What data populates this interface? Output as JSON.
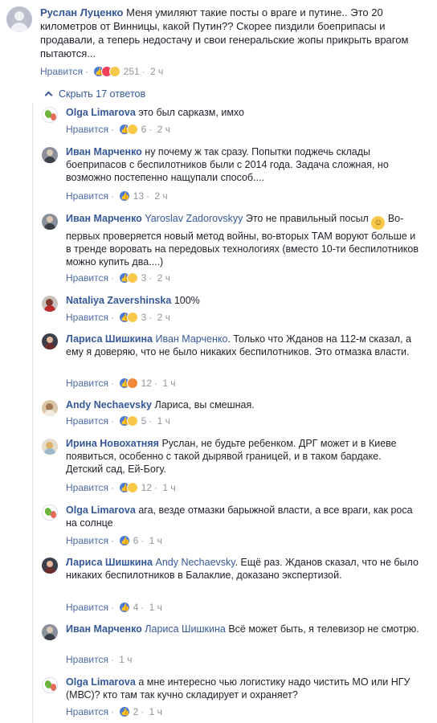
{
  "main": {
    "author": "Руслан Луценко",
    "text": "Меня умиляют такие посты о враге и путине.. Это 20 километров от Винницы, какой Путин?? Скорее пиздили боеприпасы и продавали, а теперь недостачу и свои генеральские жопы прикрыть врагом пытаются...",
    "like_label": "Нравится",
    "reaction_count": "251",
    "time": "2 ч"
  },
  "hide_replies_label": "Скрыть 17 ответов",
  "replies": [
    {
      "author": "Olga Limarova",
      "mention": "",
      "text": "это был сарказм, имхо",
      "like_label": "Нравится",
      "count": "6",
      "time": "2 ч"
    },
    {
      "author": "Иван Марченко",
      "mention": "",
      "text": "ну почему ж так сразу. Попытки поджечь склады боеприпасов с беспилотников были с 2014 года. Задача сложная, но возможно постепенно нащупали способ....",
      "like_label": "Нравится",
      "count": "13",
      "time": "2 ч"
    },
    {
      "author": "Иван Марченко",
      "mention": "Yaroslav Zadorovskyy",
      "text": "Это не правильный посыл",
      "text2": "Во-первых проверяется новый метод войны, во-вторых ТАМ воруют больше и в тренде воровать на передовых технологиях (вместо 10-ти беспилотников можно купить два....)",
      "like_label": "Нравится",
      "count": "3",
      "time": "2 ч"
    },
    {
      "author": "Nataliya Zavershinska",
      "mention": "",
      "text": "100%",
      "like_label": "Нравится",
      "count": "3",
      "time": "2 ч"
    },
    {
      "author": "Лариса Шишкина",
      "mention": "Иван Марченко",
      "text": ". Только что Жданов на 112-м сказал, а ему я доверяю, что не было никаких беспилотников. Это отмазка власти.",
      "like_label": "Нравится",
      "count": "12",
      "time": "1 ч"
    },
    {
      "author": "Andy Nechaevsky",
      "mention": "",
      "text": "Лариса, вы смешная.",
      "like_label": "Нравится",
      "count": "5",
      "time": "1 ч"
    },
    {
      "author": "Ирина Новохатняя",
      "mention": "",
      "text": "Руслан, не будьте ребенком. ДРГ может и в Киеве появиться, особенно с такой дырявой границей, и в таком бардаке. Детский сад, Ей-Богу.",
      "like_label": "Нравится",
      "count": "12",
      "time": "1 ч"
    },
    {
      "author": "Olga Limarova",
      "mention": "",
      "text": "ага, везде отмазки барыжной власти, а все враги, как роса на солнце",
      "like_label": "Нравится",
      "count": "6",
      "time": "1 ч"
    },
    {
      "author": "Лариса Шишкина",
      "mention": "Andy Nechaevsky",
      "text": ". Ещё раз. Жданов сказал, что не было никаких беспилотников в Балаклие, доказано экспертизой.",
      "like_label": "Нравится",
      "count": "4",
      "time": "1 ч"
    },
    {
      "author": "Иван Марченко",
      "mention": "Лариса Шишкина",
      "text": "Всё может быть, я телевизор не смотрю.",
      "like_label": "Нравится",
      "count": "",
      "time": "1 ч"
    },
    {
      "author": "Olga Limarova",
      "mention": "",
      "text": "а мне интересно чью логистику надо чистить МО или НГУ (МВС)? кто там так кучно складирует и охраняет?",
      "like_label": "Нравится",
      "count": "2",
      "time": "1 ч"
    }
  ],
  "colors": {
    "link": "#365899",
    "meta": "#606770",
    "text": "#1d2129"
  }
}
